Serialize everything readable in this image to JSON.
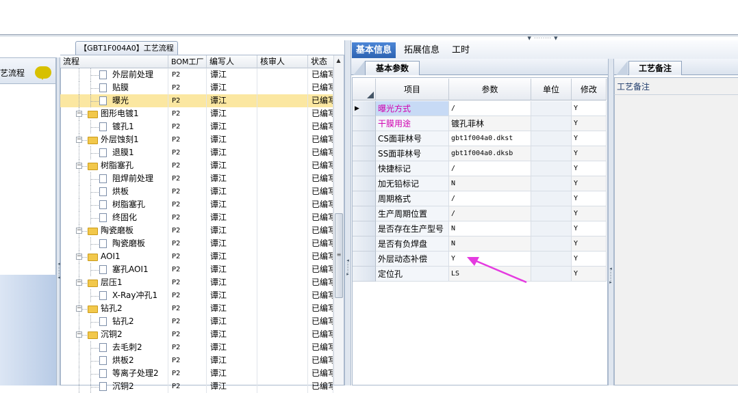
{
  "left_panel": {
    "label": "艺流程"
  },
  "tree": {
    "title": "【GBT1F004A0】工艺流程",
    "columns": [
      "流程",
      "BOM工厂",
      "编写人",
      "核审人",
      "状态"
    ],
    "rows": [
      {
        "name": "外层前处理",
        "level": 2,
        "bom": "P2",
        "writer": "谭江",
        "reviewer": "",
        "status": "已编写"
      },
      {
        "name": "贴膜",
        "level": 2,
        "bom": "P2",
        "writer": "谭江",
        "reviewer": "",
        "status": "已编写"
      },
      {
        "name": "曝光",
        "level": 2,
        "bom": "P2",
        "writer": "谭江",
        "reviewer": "",
        "status": "已编写",
        "selected": true
      },
      {
        "name": "图形电镀1",
        "level": 1,
        "bom": "P2",
        "writer": "谭江",
        "reviewer": "",
        "status": "已编写"
      },
      {
        "name": "镀孔1",
        "level": 2,
        "bom": "P2",
        "writer": "谭江",
        "reviewer": "",
        "status": "已编写"
      },
      {
        "name": "外层蚀刻1",
        "level": 1,
        "bom": "P2",
        "writer": "谭江",
        "reviewer": "",
        "status": "已编写"
      },
      {
        "name": "退膜1",
        "level": 2,
        "bom": "P2",
        "writer": "谭江",
        "reviewer": "",
        "status": "已编写"
      },
      {
        "name": "树脂塞孔",
        "level": 1,
        "bom": "P2",
        "writer": "谭江",
        "reviewer": "",
        "status": "已编写"
      },
      {
        "name": "阻焊前处理",
        "level": 2,
        "bom": "P2",
        "writer": "谭江",
        "reviewer": "",
        "status": "已编写"
      },
      {
        "name": "烘板",
        "level": 2,
        "bom": "P2",
        "writer": "谭江",
        "reviewer": "",
        "status": "已编写"
      },
      {
        "name": "树脂塞孔",
        "level": 2,
        "bom": "P2",
        "writer": "谭江",
        "reviewer": "",
        "status": "已编写"
      },
      {
        "name": "终固化",
        "level": 2,
        "bom": "P2",
        "writer": "谭江",
        "reviewer": "",
        "status": "已编写"
      },
      {
        "name": "陶瓷磨板",
        "level": 1,
        "bom": "P2",
        "writer": "谭江",
        "reviewer": "",
        "status": "已编写"
      },
      {
        "name": "陶瓷磨板",
        "level": 2,
        "bom": "P2",
        "writer": "谭江",
        "reviewer": "",
        "status": "已编写"
      },
      {
        "name": "AOI1",
        "level": 1,
        "bom": "P2",
        "writer": "谭江",
        "reviewer": "",
        "status": "已编写"
      },
      {
        "name": "塞孔AOI1",
        "level": 2,
        "bom": "P2",
        "writer": "谭江",
        "reviewer": "",
        "status": "已编写"
      },
      {
        "name": "层压1",
        "level": 1,
        "bom": "P2",
        "writer": "谭江",
        "reviewer": "",
        "status": "已编写"
      },
      {
        "name": "X-Ray冲孔1",
        "level": 2,
        "bom": "P2",
        "writer": "谭江",
        "reviewer": "",
        "status": "已编写"
      },
      {
        "name": "钻孔2",
        "level": 1,
        "bom": "P2",
        "writer": "谭江",
        "reviewer": "",
        "status": "已编写"
      },
      {
        "name": "钻孔2",
        "level": 2,
        "bom": "P2",
        "writer": "谭江",
        "reviewer": "",
        "status": "已编写"
      },
      {
        "name": "沉铜2",
        "level": 1,
        "bom": "P2",
        "writer": "谭江",
        "reviewer": "",
        "status": "已编写"
      },
      {
        "name": "去毛刺2",
        "level": 2,
        "bom": "P2",
        "writer": "谭江",
        "reviewer": "",
        "status": "已编写"
      },
      {
        "name": "烘板2",
        "level": 2,
        "bom": "P2",
        "writer": "谭江",
        "reviewer": "",
        "status": "已编写"
      },
      {
        "name": "等离子处理2",
        "level": 2,
        "bom": "P2",
        "writer": "谭江",
        "reviewer": "",
        "status": "已编写"
      },
      {
        "name": "沉铜2",
        "level": 2,
        "bom": "P2",
        "writer": "谭江",
        "reviewer": "",
        "status": "已编写"
      }
    ]
  },
  "tabs": [
    "基本信息",
    "拓展信息",
    "工时"
  ],
  "active_tab": "基本信息",
  "params": {
    "subtab": "基本参数",
    "columns": [
      "项目",
      "参数",
      "单位",
      "修改"
    ],
    "rows": [
      {
        "item": "曝光方式",
        "value": "/",
        "unit": "",
        "modify": "Y",
        "color": "#d000b0",
        "current": true
      },
      {
        "item": "干膜用途",
        "value": "镀孔菲林",
        "unit": "",
        "modify": "Y",
        "color": "#d000b0"
      },
      {
        "item": "CS面菲林号",
        "value": "gbt1f004a0.dkst",
        "unit": "",
        "modify": "Y"
      },
      {
        "item": "SS面菲林号",
        "value": "gbt1f004a0.dksb",
        "unit": "",
        "modify": "Y"
      },
      {
        "item": "快捷标记",
        "value": "/",
        "unit": "",
        "modify": "Y"
      },
      {
        "item": "加无铅标记",
        "value": "N",
        "unit": "",
        "modify": "Y"
      },
      {
        "item": "周期格式",
        "value": "/",
        "unit": "",
        "modify": "Y"
      },
      {
        "item": "生产周期位置",
        "value": "/",
        "unit": "",
        "modify": "Y"
      },
      {
        "item": "是否存在生产型号",
        "value": "N",
        "unit": "",
        "modify": "Y"
      },
      {
        "item": "是否有负焊盘",
        "value": "N",
        "unit": "",
        "modify": "Y"
      },
      {
        "item": "外层动态补偿",
        "value": "Y",
        "unit": "",
        "modify": "Y"
      },
      {
        "item": "定位孔",
        "value": "LS",
        "unit": "",
        "modify": "Y"
      }
    ]
  },
  "notes": {
    "tab": "工艺备注",
    "label": "工艺备注"
  },
  "colors": {
    "accent_tab": "#2d63b2",
    "selected_row": "#fbe7a1",
    "annotation_arrow": "#e53be0",
    "highlight_text": "#d000b0"
  },
  "icons": [
    "chat-bubble-icon",
    "folder-icon",
    "file-icon",
    "arrow-annotation-icon"
  ]
}
